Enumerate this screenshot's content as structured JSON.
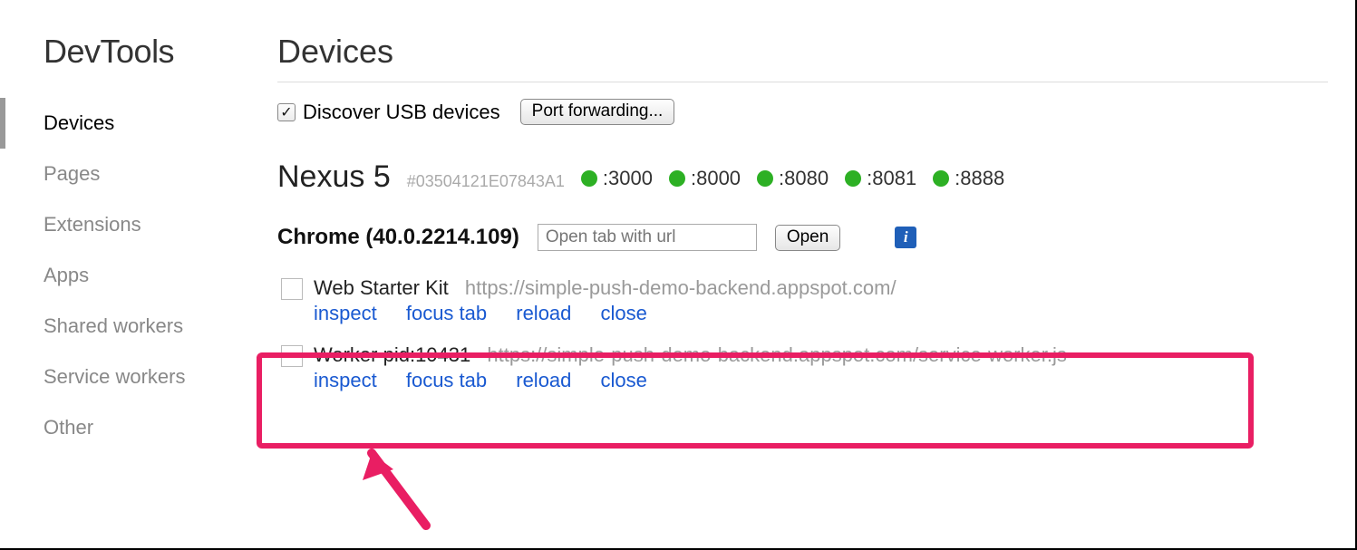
{
  "brand": "DevTools",
  "sidebar": {
    "items": [
      {
        "label": "Devices",
        "active": true
      },
      {
        "label": "Pages"
      },
      {
        "label": "Extensions"
      },
      {
        "label": "Apps"
      },
      {
        "label": "Shared workers"
      },
      {
        "label": "Service workers"
      },
      {
        "label": "Other"
      }
    ]
  },
  "page": {
    "title": "Devices",
    "discover_label": "Discover USB devices",
    "discover_checked": true,
    "port_forwarding_label": "Port forwarding..."
  },
  "device": {
    "name": "Nexus 5",
    "serial": "#03504121E07843A1",
    "ports": [
      ":3000",
      ":8000",
      ":8080",
      ":8081",
      ":8888"
    ]
  },
  "browser": {
    "label": "Chrome (40.0.2214.109)",
    "url_placeholder": "Open tab with url",
    "open_label": "Open"
  },
  "targets": [
    {
      "title": "Web Starter Kit",
      "url": "https://simple-push-demo-backend.appspot.com/",
      "actions": [
        "inspect",
        "focus tab",
        "reload",
        "close"
      ]
    },
    {
      "title": "Worker pid:10431",
      "url": "https://simple-push-demo-backend.appspot.com/service-worker.js",
      "actions": [
        "inspect",
        "focus tab",
        "reload",
        "close"
      ]
    }
  ],
  "colors": {
    "link": "#1959d1",
    "highlight": "#e91e63",
    "port_dot": "#2db024"
  }
}
